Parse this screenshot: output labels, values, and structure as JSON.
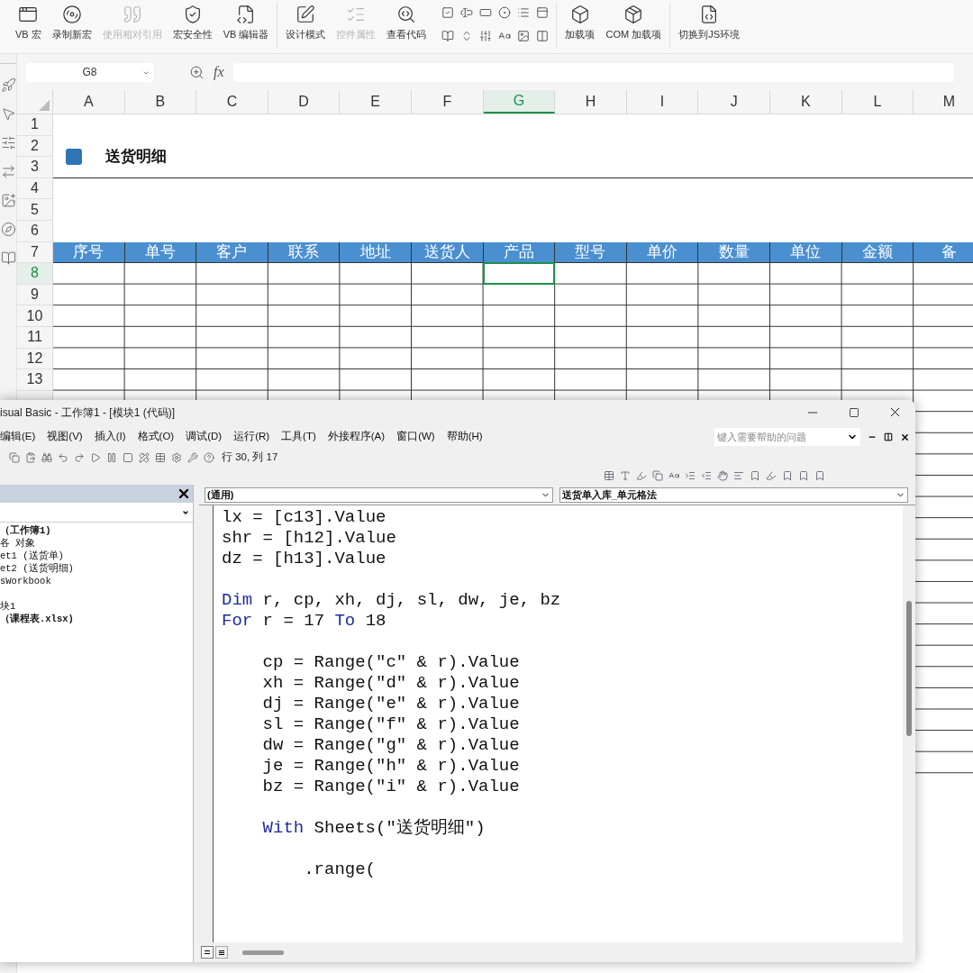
{
  "ribbon": {
    "groups": [
      [
        {
          "label": "VB 宏",
          "disabled": false
        },
        {
          "label": "录制新宏",
          "disabled": false
        },
        {
          "label": "使用相对引用",
          "disabled": true
        },
        {
          "label": "宏安全性",
          "disabled": false
        },
        {
          "label": "VB 编辑器",
          "disabled": false
        }
      ],
      [
        {
          "label": "设计模式",
          "disabled": false
        },
        {
          "label": "控件属性",
          "disabled": true
        },
        {
          "label": "查看代码",
          "disabled": false
        }
      ],
      [
        {
          "label": "加载项",
          "disabled": false
        },
        {
          "label": "COM 加载项",
          "disabled": false
        }
      ],
      [
        {
          "label": "切换到JS环境",
          "disabled": false
        }
      ]
    ]
  },
  "formula_bar": {
    "name_box": "G8",
    "function_label": "fx"
  },
  "sheet": {
    "columns": [
      {
        "label": "A",
        "selected": false
      },
      {
        "label": "B",
        "selected": false
      },
      {
        "label": "C",
        "selected": false
      },
      {
        "label": "D",
        "selected": false
      },
      {
        "label": "E",
        "selected": false
      },
      {
        "label": "F",
        "selected": false
      },
      {
        "label": "G",
        "selected": true
      },
      {
        "label": "H",
        "selected": false
      },
      {
        "label": "I",
        "selected": false
      },
      {
        "label": "J",
        "selected": false
      },
      {
        "label": "K",
        "selected": false
      },
      {
        "label": "L",
        "selected": false
      },
      {
        "label": "M",
        "selected": false
      }
    ],
    "rows": [
      {
        "label": "1",
        "selected": false
      },
      {
        "label": "2",
        "selected": false
      },
      {
        "label": "3",
        "selected": false
      },
      {
        "label": "4",
        "selected": false
      },
      {
        "label": "5",
        "selected": false
      },
      {
        "label": "6",
        "selected": false
      },
      {
        "label": "7",
        "selected": false
      },
      {
        "label": "8",
        "selected": true
      },
      {
        "label": "9",
        "selected": false
      },
      {
        "label": "10",
        "selected": false
      },
      {
        "label": "11",
        "selected": false
      },
      {
        "label": "12",
        "selected": false
      },
      {
        "label": "13",
        "selected": false
      }
    ],
    "title": "送货明细",
    "headers": [
      "序号",
      "单号",
      "客户",
      "联系",
      "地址",
      "送货人",
      "产品",
      "型号",
      "单价",
      "数量",
      "单位",
      "金额",
      "备"
    ]
  },
  "vbe": {
    "title": "isual Basic - 工作簿1 - [模块1 (代码)]",
    "menu": [
      "编辑(E)",
      "视图(V)",
      "插入(I)",
      "格式(O)",
      "调试(D)",
      "运行(R)",
      "工具(T)",
      "外接程序(A)",
      "窗口(W)",
      "帮助(H)"
    ],
    "help_placeholder": "键入需要帮助的问题",
    "position": "行 30, 列 17",
    "project": {
      "items": [
        "（工作簿1)",
        "各 对象",
        "et1 (送货单)",
        "et2 (送货明细)",
        "sWorkbook",
        "块1",
        "（课程表.xlsx)"
      ]
    },
    "code": {
      "object": "(通用)",
      "procedure": "送货单入库_单元格法",
      "blocks": [
        [
          {
            "segments": [
              {
                "kind": "plain",
                "text": "lx = [c13].Value"
              }
            ]
          },
          {
            "segments": [
              {
                "kind": "plain",
                "text": "shr = [h12].Value"
              }
            ]
          },
          {
            "segments": [
              {
                "kind": "plain",
                "text": "dz = [h13].Value"
              }
            ]
          }
        ],
        [
          {
            "segments": [
              {
                "kind": "keyword",
                "text": "Dim"
              },
              {
                "kind": "plain",
                "text": " r, cp, xh, dj, sl, dw, je, bz"
              }
            ]
          },
          {
            "segments": [
              {
                "kind": "keyword",
                "text": "For"
              },
              {
                "kind": "plain",
                "text": " r = 17 "
              },
              {
                "kind": "keyword",
                "text": "To"
              },
              {
                "kind": "plain",
                "text": " 18"
              }
            ],
            "children": [
              [
                {
                  "segments": [
                    {
                      "kind": "plain",
                      "text": "cp = Range(\"c\" & r).Value"
                    }
                  ]
                },
                {
                  "segments": [
                    {
                      "kind": "plain",
                      "text": "xh = Range(\"d\" & r).Value"
                    }
                  ]
                },
                {
                  "segments": [
                    {
                      "kind": "plain",
                      "text": "dj = Range(\"e\" & r).Value"
                    }
                  ]
                },
                {
                  "segments": [
                    {
                      "kind": "plain",
                      "text": "sl = Range(\"f\" & r).Value"
                    }
                  ]
                },
                {
                  "segments": [
                    {
                      "kind": "plain",
                      "text": "dw = Range(\"g\" & r).Value"
                    }
                  ]
                },
                {
                  "segments": [
                    {
                      "kind": "plain",
                      "text": "je = Range(\"h\" & r).Value"
                    }
                  ]
                },
                {
                  "segments": [
                    {
                      "kind": "plain",
                      "text": "bz = Range(\"i\" & r).Value"
                    }
                  ]
                }
              ],
              [
                {
                  "segments": [
                    {
                      "kind": "keyword",
                      "text": "With"
                    },
                    {
                      "kind": "plain",
                      "text": " Sheets(\"送货明细\")"
                    }
                  ],
                  "children": [
                    [
                      {
                        "segments": [
                          {
                            "kind": "plain",
                            "text": ".range("
                          }
                        ]
                      }
                    ]
                  ]
                }
              ]
            ]
          }
        ]
      ]
    }
  }
}
